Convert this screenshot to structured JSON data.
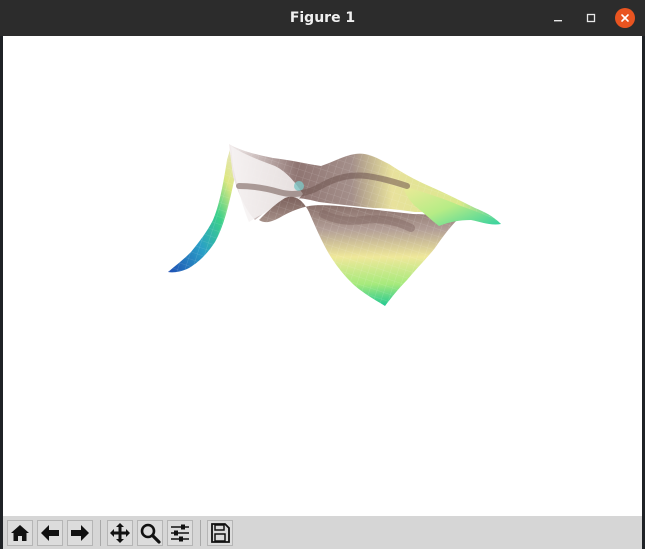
{
  "window": {
    "title": "Figure 1"
  },
  "titlebar_buttons": [
    {
      "name": "minimize",
      "icon": "minimize-icon"
    },
    {
      "name": "maximize",
      "icon": "maximize-icon"
    },
    {
      "name": "close",
      "icon": "close-icon",
      "color": "#e95420"
    }
  ],
  "toolbar": {
    "tools": [
      {
        "name": "home",
        "icon": "home-icon"
      },
      {
        "name": "back",
        "icon": "arrow-left-icon"
      },
      {
        "name": "forward",
        "icon": "arrow-right-icon"
      },
      {
        "name": "pan",
        "icon": "move-icon"
      },
      {
        "name": "zoom",
        "icon": "magnifier-icon"
      },
      {
        "name": "configure-subplots",
        "icon": "sliders-icon"
      },
      {
        "name": "save",
        "icon": "floppy-disk-icon"
      }
    ]
  },
  "plot": {
    "type": "3d-surface",
    "colormap": [
      "#1f4fb5",
      "#29a0c8",
      "#2ecf8a",
      "#a8ea78",
      "#f2f08c",
      "#e6dca0",
      "#b39e96",
      "#7c605c",
      "#f4f0f0"
    ],
    "axes_visible": false
  }
}
